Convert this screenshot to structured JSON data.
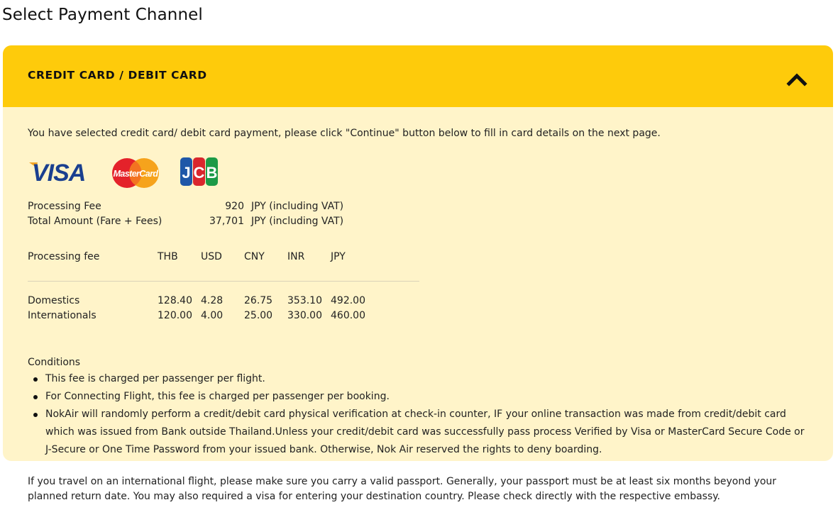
{
  "page": {
    "title": "Select Payment Channel"
  },
  "panel": {
    "header_title": "CREDIT CARD / DEBIT CARD",
    "toggle_icon": "chevron-up-icon",
    "accent_color": "#fecb0b",
    "body_color": "#fff4c9",
    "intro": "You have selected credit card/ debit card payment, please click \"Continue\" button below to fill in card details on the next page.",
    "card_logos": [
      {
        "name": "visa-logo",
        "text": "VISA"
      },
      {
        "name": "mastercard-logo",
        "text": "MasterCard"
      },
      {
        "name": "jcb-logo",
        "text": "JCB"
      }
    ],
    "fees": [
      {
        "label": "Processing Fee",
        "value": "920",
        "unit": "JPY (including VAT)"
      },
      {
        "label": "Total Amount (Fare + Fees)",
        "value": "37,701",
        "unit": "JPY (including VAT)"
      }
    ],
    "rates": {
      "headers": [
        "Processing fee",
        "THB",
        "USD",
        "CNY",
        "INR",
        "JPY"
      ],
      "rows": [
        [
          "Domestics",
          "128.40",
          "4.28",
          "26.75",
          "353.10",
          "492.00"
        ],
        [
          "Internationals",
          "120.00",
          "4.00",
          "25.00",
          "330.00",
          "460.00"
        ]
      ]
    },
    "conditions_title": "Conditions",
    "conditions": [
      "This fee is charged per passenger per flight.",
      "For Connecting Flight, this fee is charged per passenger per booking.",
      "NokAir will randomly perform a credit/debit card physical verification at check-in counter, IF your online transaction was made from credit/debit card which was issued from Bank outside Thailand.Unless your credit/debit card was successfully pass process Verified by Visa or MasterCard Secure Code or J-Secure or One Time Password from your issued bank. Otherwise, Nok Air reserved the rights to deny boarding."
    ]
  },
  "footer_note": "If you travel on an international flight, please make sure you carry a valid passport. Generally, your passport must be at least six months beyond your planned return date. You may also required a visa for entering your destination country. Please check directly with the respective embassy."
}
